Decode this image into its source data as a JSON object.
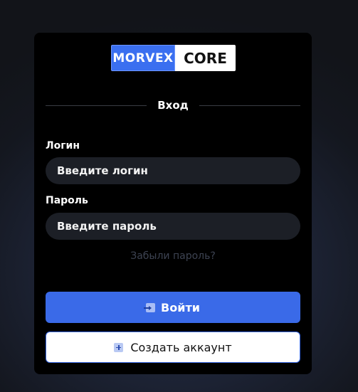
{
  "logo": {
    "left": "MORVEX",
    "right": "CORE"
  },
  "form": {
    "title": "Вход",
    "login_label": "Логин",
    "login_placeholder": "Введите логин",
    "password_label": "Пароль",
    "password_placeholder": "Введите пароль",
    "forgot_link": "Забыли пароль?",
    "submit_label": "Войти",
    "register_label": "Создать аккаунт"
  },
  "colors": {
    "accent": "#3a6ae8",
    "card_bg": "#000000",
    "input_bg": "#1c1f26",
    "forgot_text": "#3d4352"
  },
  "icons": {
    "submit": "login-icon",
    "register": "plus-icon"
  }
}
